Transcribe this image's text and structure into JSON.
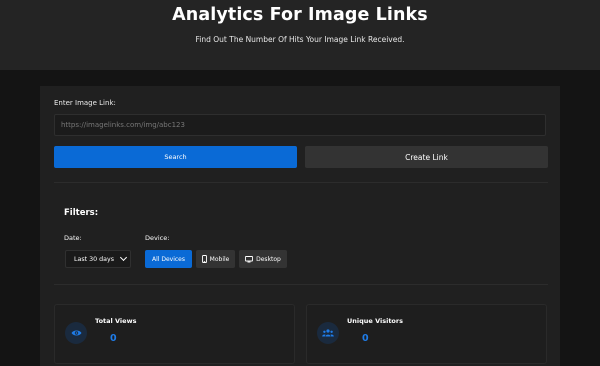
{
  "header": {
    "title": "Analytics For Image Links",
    "subtitle": "Find Out The Number Of Hits Your Image Link Received."
  },
  "form": {
    "link_label": "Enter Image Link:",
    "link_placeholder": "https://imagelinks.com/img/abc123",
    "link_value": "",
    "search_label": "Search",
    "create_label": "Create Link"
  },
  "filters": {
    "title": "Filters:",
    "date_label": "Date:",
    "date_selected": "Last 30 days",
    "device_label": "Device:",
    "devices": [
      {
        "label": "All Devices",
        "icon": "",
        "active": true
      },
      {
        "label": "Mobile",
        "icon": "mobile-icon",
        "active": false
      },
      {
        "label": "Desktop",
        "icon": "desktop-icon",
        "active": false
      }
    ]
  },
  "stats": [
    {
      "label": "Total Views",
      "value": "0",
      "icon": "eye-icon"
    },
    {
      "label": "Unique Visitors",
      "value": "0",
      "icon": "users-icon"
    }
  ],
  "colors": {
    "accent": "#0a6ad6",
    "value": "#1f7ce8",
    "background": "#141414",
    "card": "#202020"
  }
}
